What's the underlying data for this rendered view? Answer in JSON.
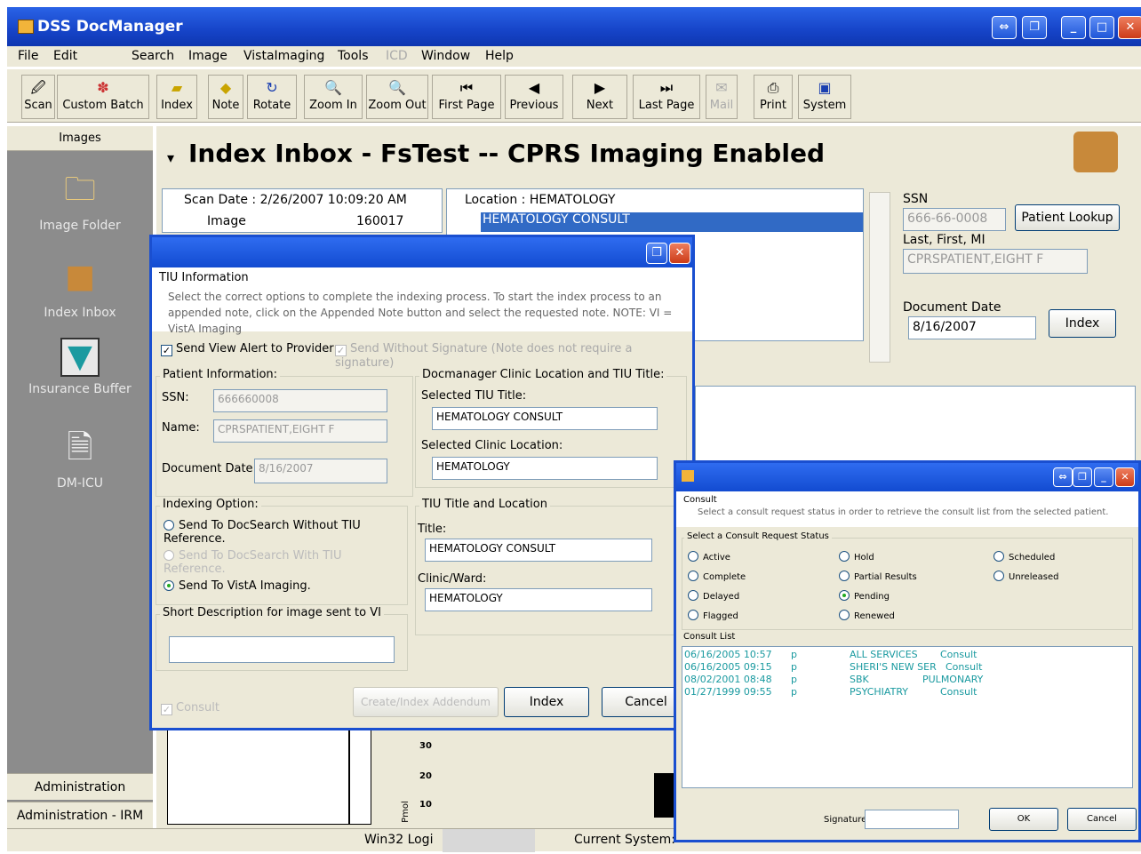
{
  "app": {
    "title": "DSS DocManager"
  },
  "menu": [
    "File",
    "Edit",
    "Search",
    "Image",
    "VistaImaging",
    "Tools",
    "ICD",
    "Window",
    "Help"
  ],
  "toolbar": {
    "scan": "Scan",
    "custom_batch": "Custom Batch",
    "index": "Index",
    "note": "Note",
    "rotate": "Rotate",
    "zoom_in": "Zoom In",
    "zoom_out": "Zoom Out",
    "first_page": "First Page",
    "previous": "Previous",
    "next": "Next",
    "last_page": "Last Page",
    "mail": "Mail",
    "print": "Print",
    "system": "System"
  },
  "sidebar": {
    "header": "Images",
    "items": [
      {
        "label": "Image Folder",
        "icon": "folder-icon"
      },
      {
        "label": "Index Inbox",
        "icon": "inbox-box-icon"
      },
      {
        "label": "Insurance Buffer",
        "icon": "funnel-icon"
      },
      {
        "label": "DM-ICU",
        "icon": "document-icon"
      }
    ],
    "footer": [
      "Administration",
      "Administration - IRM"
    ]
  },
  "main": {
    "heading": "Index Inbox - FsTest -- CPRS Imaging Enabled",
    "scan_group": "Scan Date : 2/26/2007 10:09:20 AM",
    "image_label": "Image",
    "image_value": "160017",
    "location_group": "Location : HEMATOLOGY",
    "location_row": "HEMATOLOGY CONSULT",
    "ssn_label": "SSN",
    "ssn_value": "666-66-0008",
    "patient_lookup": "Patient Lookup",
    "name_label": "Last, First, MI",
    "name_value": "CPRSPATIENT,EIGHT F",
    "doc_date_label": "Document Date",
    "doc_date_value": "8/16/2007",
    "index_button": "Index"
  },
  "status": {
    "win32": "Win32 Logi",
    "current_system": "Current System:"
  },
  "tiu": {
    "section_title": "TIU Information",
    "instructions": "Select the correct options to complete the indexing process. To start the index process to an appended note, click on the Appended Note button and select the requested note.   NOTE: VI = VistA Imaging",
    "send_view_alert": "Send View Alert to Provider",
    "send_without_signature": "Send Without Signature (Note does not require a signature)",
    "patient_info": "Patient Information:",
    "ssn_label": "SSN:",
    "ssn_value": "666660008",
    "name_label": "Name:",
    "name_value": "CPRSPATIENT,EIGHT F",
    "doc_date_label": "Document Date:",
    "doc_date_value": "8/16/2007",
    "docman_group": "Docmanager Clinic Location and TIU Title:",
    "selected_tiu_label": "Selected TIU Title:",
    "selected_tiu_value": "HEMATOLOGY CONSULT",
    "selected_clinic_label": "Selected Clinic Location:",
    "selected_clinic_value": "HEMATOLOGY",
    "indexing_option": "Indexing Option:",
    "opt1": "Send To DocSearch Without TIU Reference.",
    "opt2": "Send To DocSearch With TIU Reference.",
    "opt3": "Send To VistA Imaging.",
    "tiu_title_location": "TIU Title and Location",
    "title_label": "Title:",
    "title_value": "HEMATOLOGY CONSULT",
    "clinic_label": "Clinic/Ward:",
    "clinic_value": "HEMATOLOGY",
    "short_desc": "Short Description for image sent to VI",
    "consult": "Consult",
    "create_addendum": "Create/Index Addendum",
    "index": "Index",
    "cancel": "Cancel"
  },
  "consult": {
    "title": "Consult",
    "instructions": "Select a consult request status in order to retrieve the consult list from the selected patient.",
    "status_group": "Select a Consult Request Status",
    "statuses": [
      "Active",
      "Hold",
      "Scheduled",
      "Complete",
      "Partial Results",
      "Unreleased",
      "Delayed",
      "Pending",
      "Flagged",
      "Renewed"
    ],
    "list_label": "Consult List",
    "rows": [
      {
        "date": "06/16/2005 10:57",
        "code": "p",
        "service": "ALL SERVICES",
        "type": "Consult"
      },
      {
        "date": "06/16/2005 09:15",
        "code": "p",
        "service": "SHERI'S NEW SER",
        "type": "Consult"
      },
      {
        "date": "08/02/2001 08:48",
        "code": "p",
        "service": "SBK",
        "type": "PULMONARY"
      },
      {
        "date": "01/27/1999 09:55",
        "code": "p",
        "service": "PSYCHIATRY",
        "type": "Consult"
      }
    ],
    "signature_label": "Signature",
    "ok": "OK",
    "cancel": "Cancel"
  },
  "chart_fragment": {
    "ylabel": "Pmol",
    "ticks": [
      "30",
      "20",
      "10"
    ]
  },
  "colors": {
    "titlebar": "#1644c8",
    "chrome": "#ece9d8",
    "sidebar": "#8c8c8c",
    "selection": "#316ac5",
    "consult_text": "#1a9aa0"
  }
}
